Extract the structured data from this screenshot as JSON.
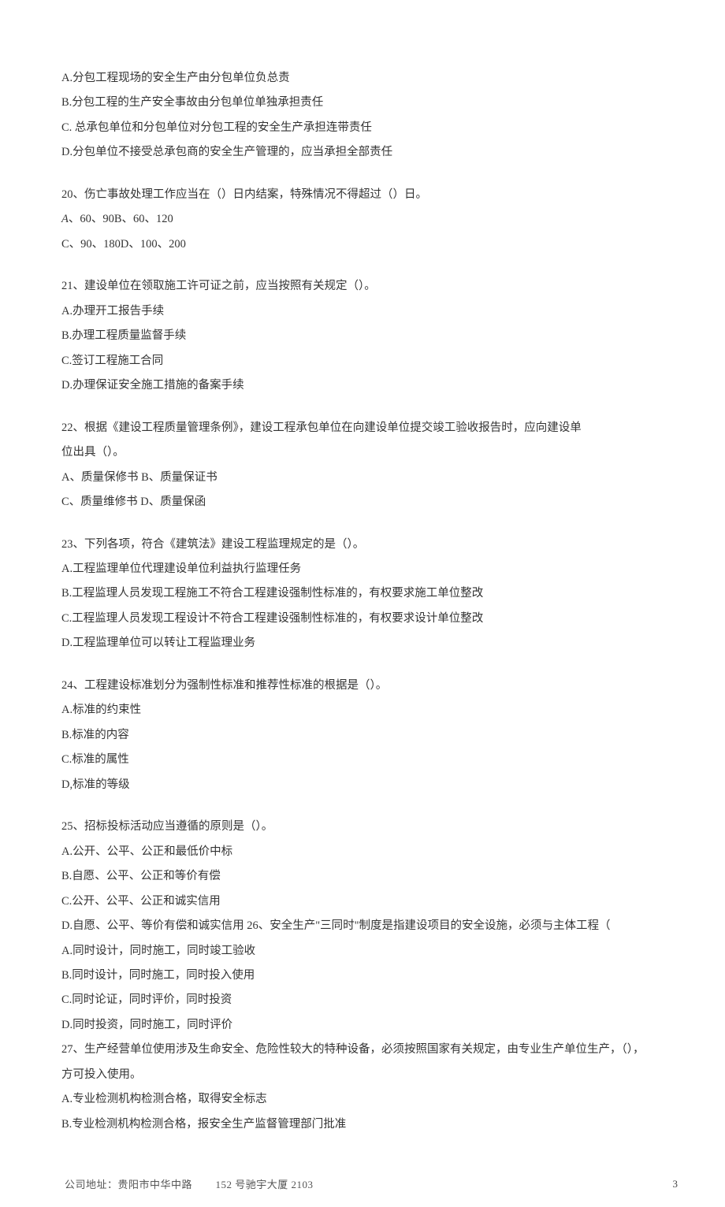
{
  "q19": {
    "optA": "A.分包工程现场的安全生产由分包单位负总责",
    "optB": "B.分包工程的生产安全事故由分包单位单独承担责任",
    "optC": "C. 总承包单位和分包单位对分包工程的安全生产承担连带责任",
    "optD": "D.分包单位不接受总承包商的安全生产管理的，应当承担全部责任"
  },
  "q20": {
    "stem": "20、伤亡事故处理工作应当在（）日内结案，特殊情况不得超过（）日。",
    "row1_prefix": "A",
    "row1_rest": "、60、90B、60、120",
    "row2": "C、90、180D、100、200"
  },
  "q21": {
    "stem": "21、建设单位在领取施工许可证之前，应当按照有关规定（）。",
    "optA": "A.办理开工报告手续",
    "optB": "B.办理工程质量监督手续",
    "optC": "C.签订工程施工合同",
    "optD": "D.办理保证安全施工措施的备案手续"
  },
  "q22": {
    "stem1": "22、根据《建设工程质量管理条例》，建设工程承包单位在向建设单位提交竣工验收报告时，应向建设单",
    "stem2": "位出具（）。",
    "row1": "A、质量保修书 B、质量保证书",
    "row2": "C、质量维修书 D、质量保函"
  },
  "q23": {
    "stem": "23、下列各项，符合《建筑法》建设工程监理规定的是（）。",
    "optA": "A.工程监理单位代理建设单位利益执行监理任务",
    "optB": "B.工程监理人员发现工程施工不符合工程建设强制性标准的，有权要求施工单位整改",
    "optC": "C.工程监理人员发现工程设计不符合工程建设强制性标准的，有权要求设计单位整改",
    "optD": "D.工程监理单位可以转让工程监理业务"
  },
  "q24": {
    "stem": "24、工程建设标准划分为强制性标准和推荐性标准的根据是（）。",
    "optA": "A.标准的约束性",
    "optB": "B.标准的内容",
    "optC": "C.标准的属性",
    "optD": "D,标准的等级"
  },
  "q25": {
    "stem": "25、招标投标活动应当遵循的原则是（）。",
    "optA": "A.公开、公平、公正和最低价中标",
    "optB": "B.自愿、公平、公正和等价有偿",
    "optC": "C.公开、公平、公正和诚实信用",
    "optD": "D.自愿、公平、等价有偿和诚实信用 26、安全生产\"三同时\"制度是指建设项目的安全设施，必须与主体工程（"
  },
  "q26": {
    "optA": "A.同时设计，同时施工，同时竣工验收",
    "optB": "B.同时设计，同时施工，同时投入使用",
    "optC": "C.同时论证，同时评价，同时投资",
    "optD": "D.同时投资，同时施工，同时评价"
  },
  "q27": {
    "stem1": "27、生产经营单位使用涉及生命安全、危险性较大的特种设备，必须按照国家有关规定，由专业生产单位生产，（），",
    "stem2": "方可投入使用。",
    "optA": "A.专业检测机构检测合格，取得安全标志",
    "optB": "B.专业检测机构检测合格，报安全生产监督管理部门批准"
  },
  "footer": {
    "addr_a": "公司地址：贵阳市中华中路",
    "addr_b": "152 号驰宇大厦 2103",
    "page_num": "3"
  }
}
